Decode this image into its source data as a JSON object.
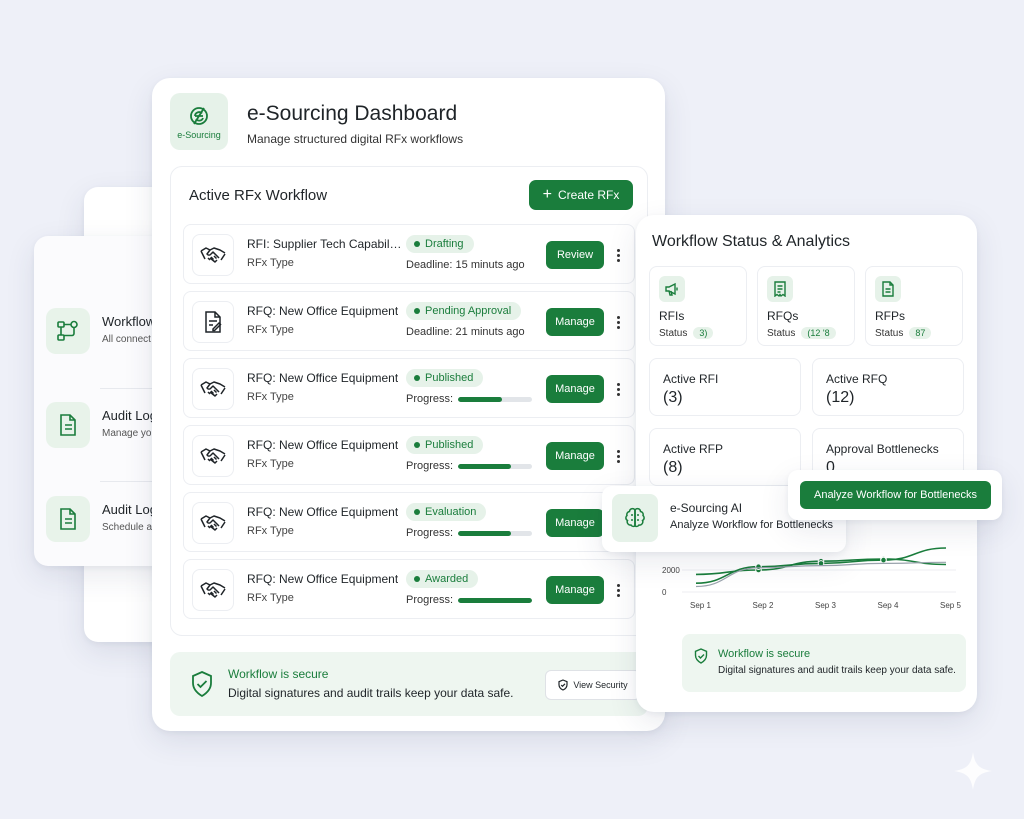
{
  "dashboard": {
    "logo_text": "e-Sourcing",
    "title": "e-Sourcing Dashboard",
    "subtitle": "Manage structured digital RFx workflows"
  },
  "workflow_panel": {
    "title": "Active RFx Workflow",
    "create_button": "Create RFx",
    "rows": [
      {
        "name": "RFI: Supplier Tech Capabilities",
        "type": "RFx Type",
        "status": "Drafting",
        "meta_label": "Deadline: 15 minuts ago",
        "progress": null,
        "action": "Review",
        "icon": "handshake-icon"
      },
      {
        "name": "RFQ: New Office Equipment",
        "type": "RFx Type",
        "status": "Pending Approval",
        "meta_label": "Deadline: 21 minuts ago",
        "progress": null,
        "action": "Manage",
        "icon": "document-edit-icon"
      },
      {
        "name": "RFQ: New Office Equipment",
        "type": "RFx Type",
        "status": "Published",
        "meta_label": "Progress:",
        "progress": 0.6,
        "action": "Manage",
        "icon": "handshake-icon"
      },
      {
        "name": "RFQ: New Office Equipment",
        "type": "RFx Type",
        "status": "Published",
        "meta_label": "Progress:",
        "progress": 0.72,
        "action": "Manage",
        "icon": "handshake-icon"
      },
      {
        "name": "RFQ: New Office Equipment",
        "type": "RFx Type",
        "status": "Evaluation",
        "meta_label": "Progress:",
        "progress": 0.72,
        "action": "Manage",
        "icon": "handshake-icon"
      },
      {
        "name": "RFQ: New Office Equipment",
        "type": "RFx Type",
        "status": "Awarded",
        "meta_label": "Progress:",
        "progress": 1.0,
        "action": "Manage",
        "icon": "handshake-icon"
      }
    ]
  },
  "security_banner": {
    "title": "Workflow is secure",
    "text": "Digital signatures and audit trails keep your data safe.",
    "button": "View Security"
  },
  "back_cards": [
    {
      "title": "Workflow",
      "sub": "All connect",
      "icon": "workflow-icon"
    },
    {
      "title": "Audit Log",
      "sub": "Manage yo",
      "icon": "audit-document-icon"
    },
    {
      "title": "Audit Log",
      "sub": "Schedule a",
      "icon": "audit-document-icon"
    }
  ],
  "analytics": {
    "title": "Workflow Status & Analytics",
    "stats": [
      {
        "name": "RFIs",
        "status_label": "Status",
        "badge": "3)",
        "icon": "megaphone-icon"
      },
      {
        "name": "RFQs",
        "status_label": "Status",
        "badge": "(12 '8",
        "icon": "receipt-icon"
      },
      {
        "name": "RFPs",
        "status_label": "Status",
        "badge": "87",
        "icon": "document-icon"
      }
    ],
    "metrics": [
      {
        "label": "Active RFI",
        "value": "(3)"
      },
      {
        "label": "Active RFQ",
        "value": "(12)"
      },
      {
        "label": "Active RFP",
        "value": "(8)"
      },
      {
        "label": "Approval Bottlenecks",
        "value": "0"
      }
    ],
    "secure": {
      "title": "Workflow is secure",
      "text": "Digital signatures and audit trails keep your data safe."
    }
  },
  "chart_data": {
    "type": "line",
    "x": [
      "Sep 1",
      "Sep 2",
      "Sep 3",
      "Sep 4",
      "Sep 5"
    ],
    "yticks": [
      "2000",
      "0"
    ],
    "ylim": [
      0,
      4000
    ],
    "series": [
      {
        "values": [
          1600,
          2000,
          2800,
          3000,
          2500
        ],
        "color": "#1a7d3c"
      },
      {
        "values": [
          800,
          2300,
          2600,
          2900,
          4000
        ],
        "color": "#1a7d3c"
      },
      {
        "values": [
          500,
          2200,
          2400,
          2600,
          2700
        ],
        "color": "#9aa3ad"
      }
    ],
    "grid": true
  },
  "ai": {
    "title": "e-Sourcing AI",
    "subtitle": "Analyze Workflow for Bottlenecks",
    "button": "Analyze Workflow for Bottlenecks"
  },
  "colors": {
    "accent": "#1a7d3c",
    "accent_light": "#e6f2e9",
    "background": "#eef0f8"
  }
}
